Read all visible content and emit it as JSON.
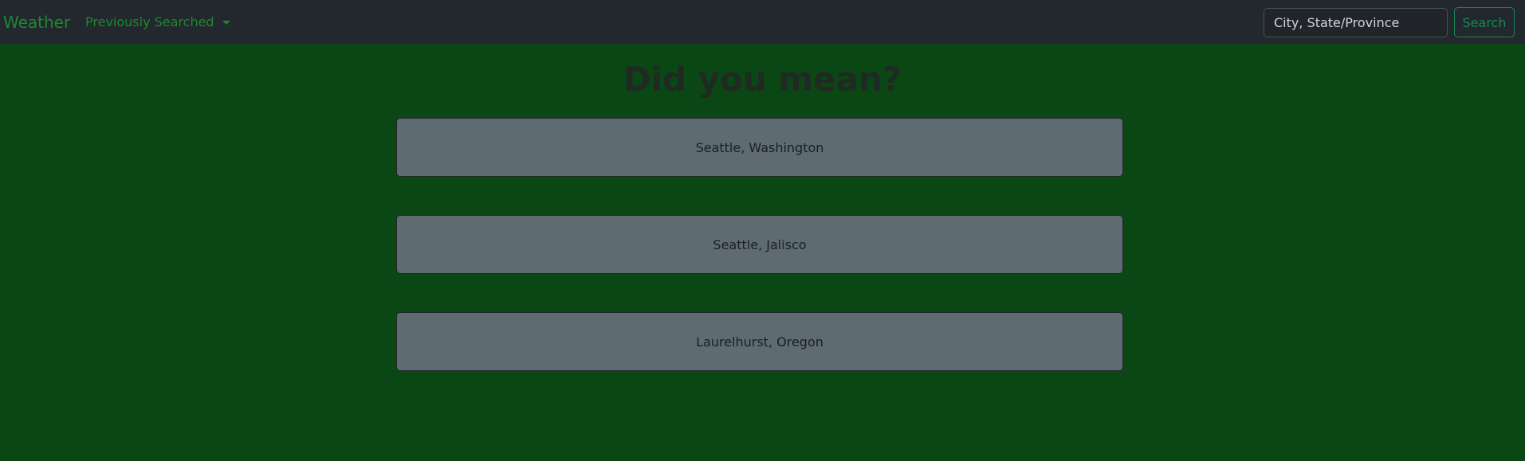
{
  "navbar": {
    "brand": "Weather",
    "dropdown_label": "Previously Searched",
    "search": {
      "placeholder": "City, State/Province",
      "value": "",
      "button_label": "Search"
    }
  },
  "main": {
    "heading": "Did you mean?",
    "suggestions": [
      "Seattle, Washington",
      "Seattle, Jalisco",
      "Laurelhurst, Oregon"
    ]
  },
  "colors": {
    "background": "#0b4714",
    "navbar": "#23272e",
    "brand": "#1a8a2e",
    "search_button": "#198754",
    "suggestion_bg": "#5f6b72"
  },
  "icons": [
    "chevron-down-icon"
  ]
}
